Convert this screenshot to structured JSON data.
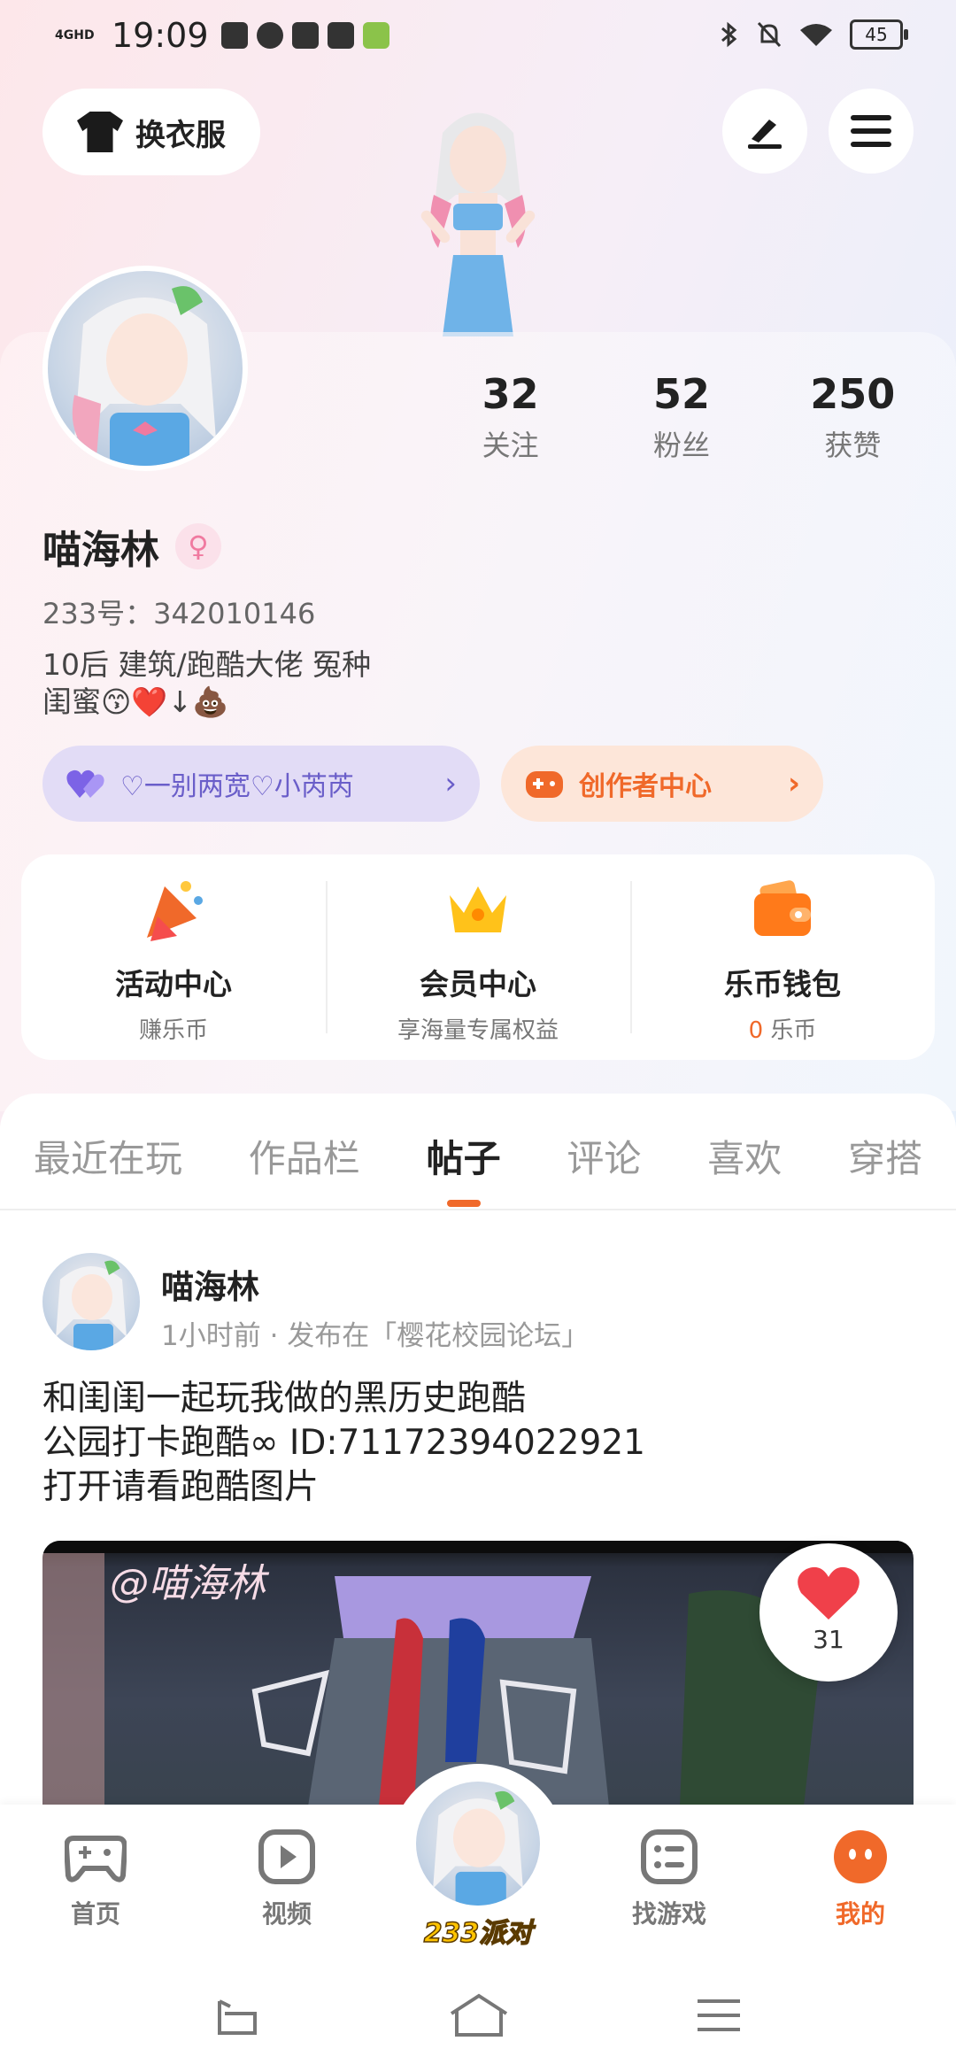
{
  "status_bar": {
    "network": "4GHD",
    "time": "19:09",
    "battery": "45"
  },
  "header": {
    "dress_label": "换衣服"
  },
  "profile": {
    "stats": [
      {
        "num": "32",
        "label": "关注"
      },
      {
        "num": "52",
        "label": "粉丝"
      },
      {
        "num": "250",
        "label": "获赞"
      }
    ],
    "name": "喵海林",
    "gender_symbol": "♀",
    "uid": "233号：342010146",
    "bio": "10后 建筑/跑酷大佬  冤种\n闺蜜😙❤️↓💩",
    "cp_label": "♡一别两宽♡小芮芮",
    "creator_label": "创作者中心"
  },
  "functions": [
    {
      "title": "活动中心",
      "sub": "赚乐币",
      "sub_value": ""
    },
    {
      "title": "会员中心",
      "sub": "享海量专属权益",
      "sub_value": ""
    },
    {
      "title": "乐币钱包",
      "sub": "乐币",
      "sub_value": "0"
    }
  ],
  "tabs": [
    "最近在玩",
    "作品栏",
    "帖子",
    "评论",
    "喜欢",
    "穿搭"
  ],
  "active_tab": "帖子",
  "post": {
    "author": "喵海林",
    "meta": "1小时前 · 发布在「樱花校园论坛」",
    "text": "和闺闺一起玩我做的黑历史跑酷\n公园打卡跑酷∞ ID:71172394022921\n打开请看跑酷图片",
    "watermark": "@喵海林",
    "like_count": "31"
  },
  "bottom_nav": [
    {
      "label": "首页"
    },
    {
      "label": "视频"
    },
    {
      "label": "233派对"
    },
    {
      "label": "找游戏"
    },
    {
      "label": "我的"
    }
  ],
  "colors": {
    "accent": "#f0692a",
    "cp_purple": "#6a5ec9",
    "like_red": "#f0404a"
  }
}
